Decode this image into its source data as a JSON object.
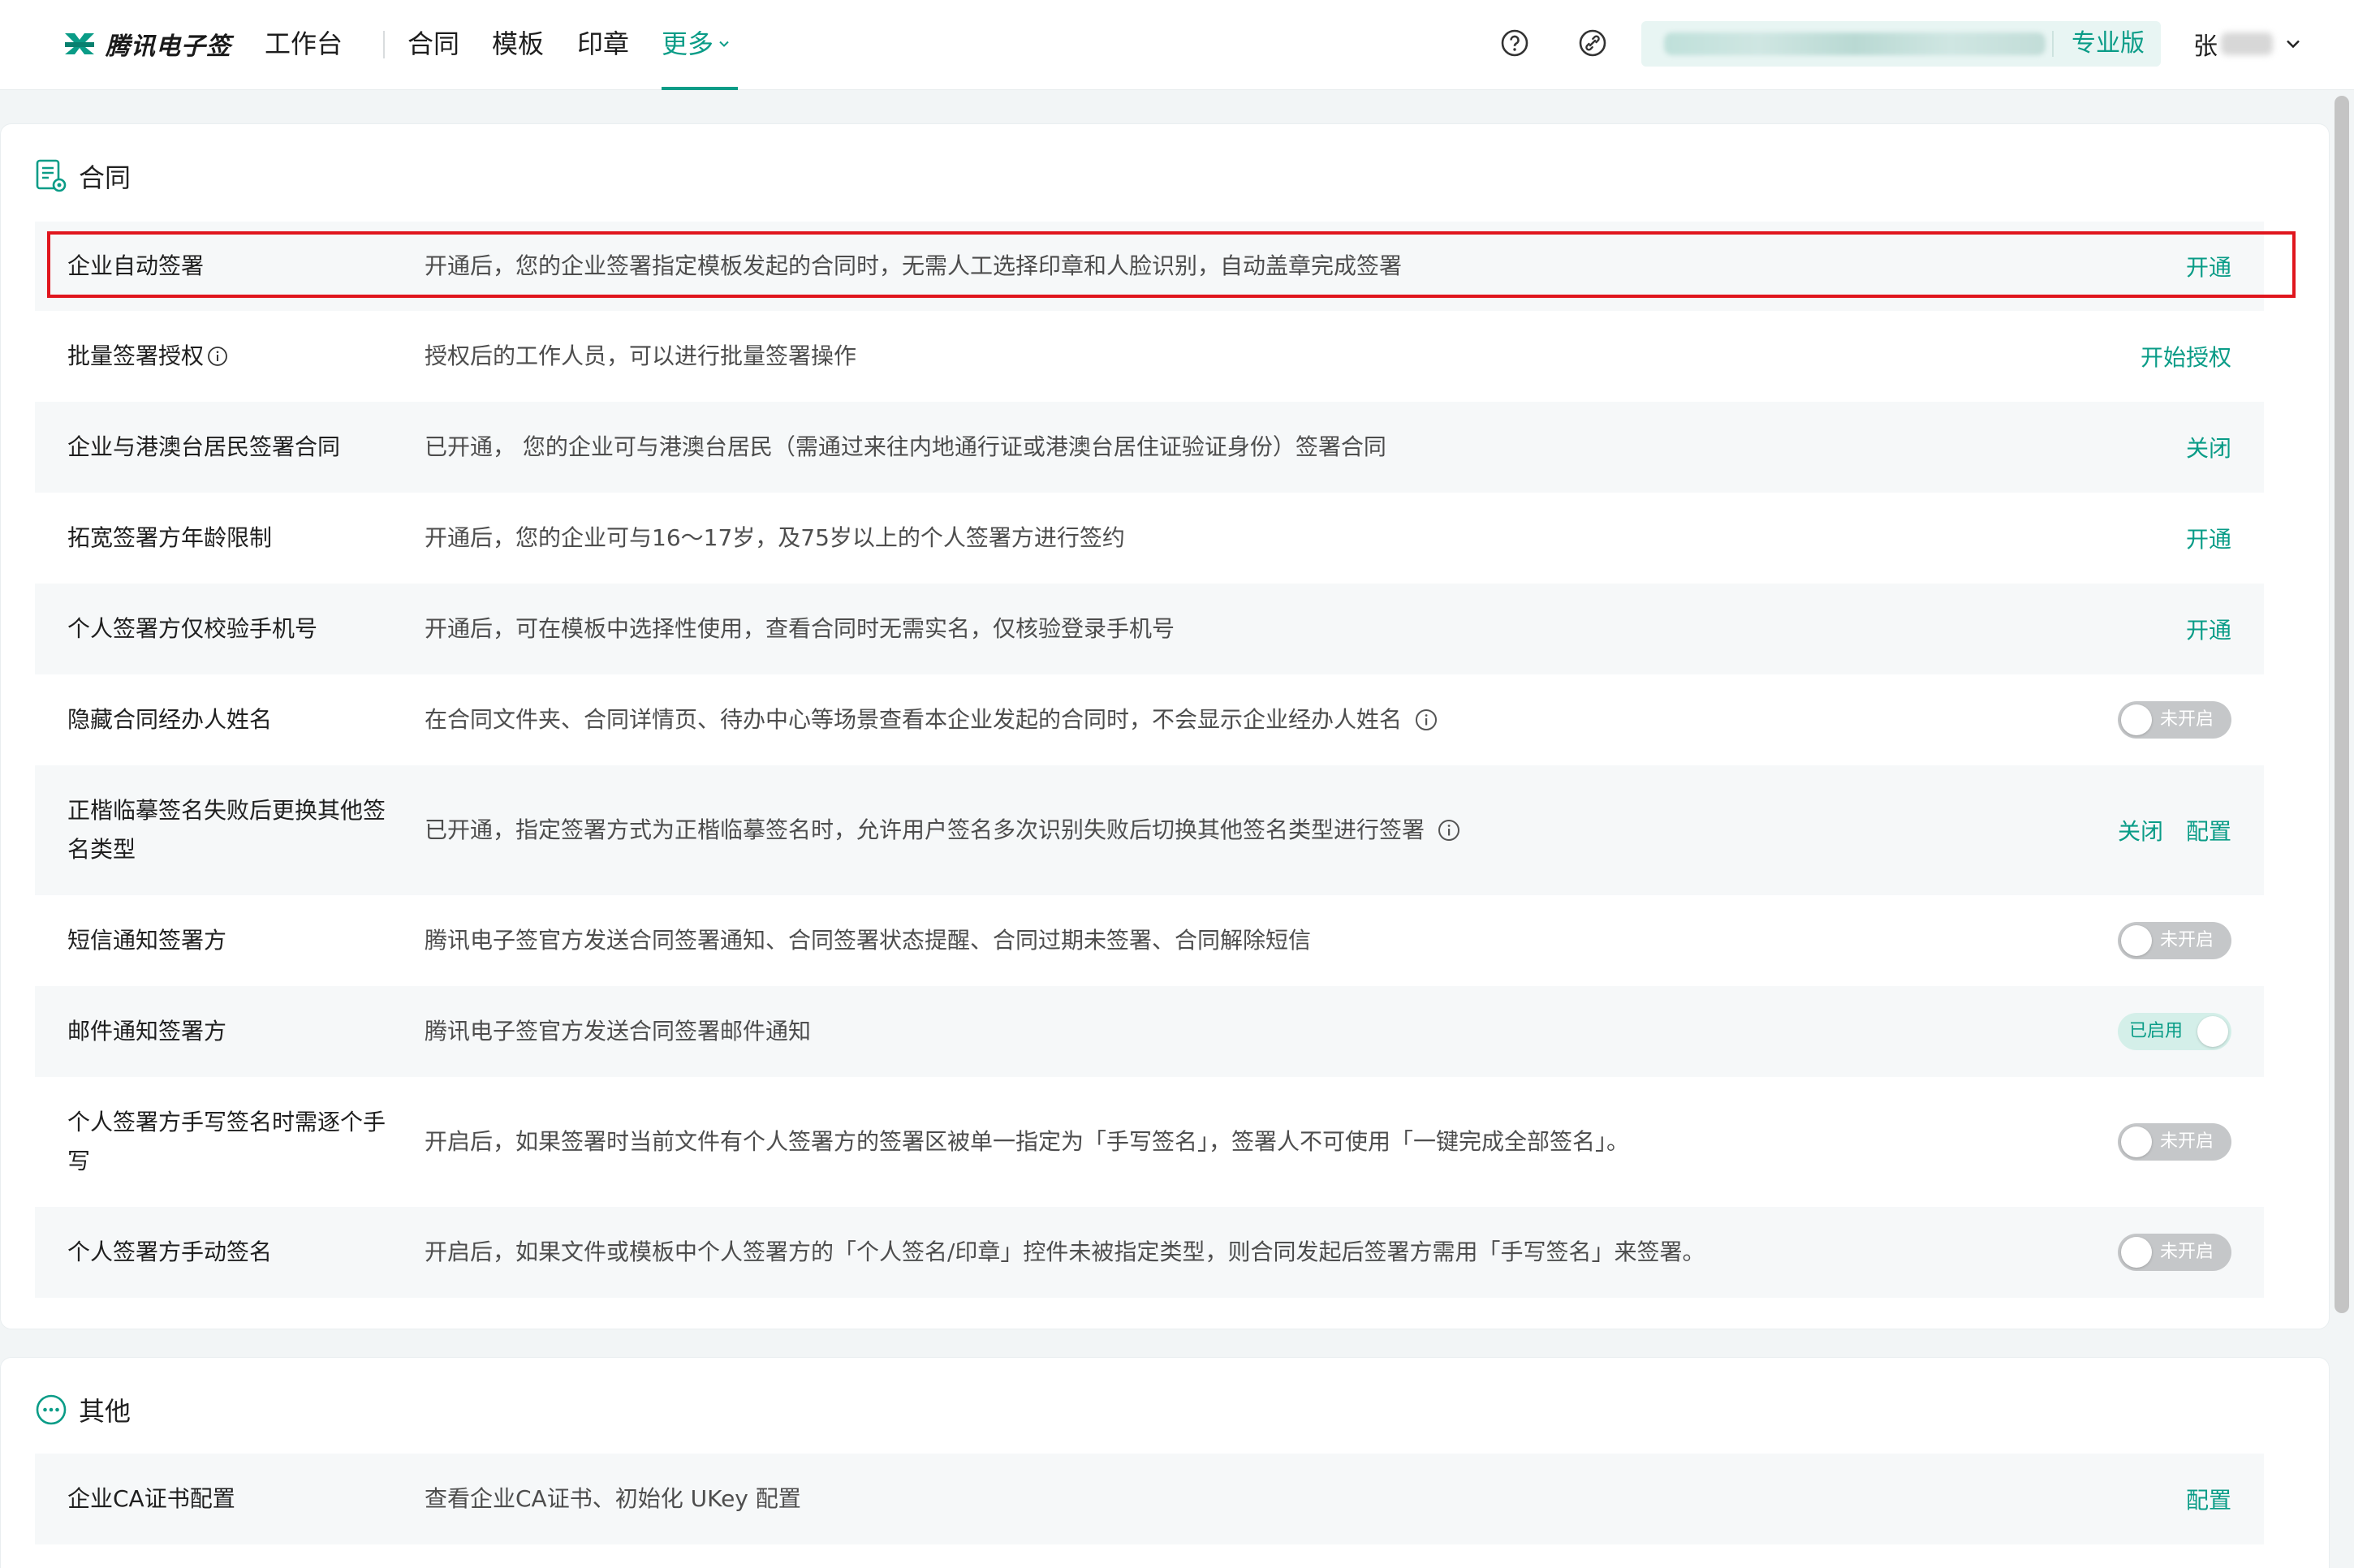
{
  "app": {
    "logo_text": "腾讯电子签",
    "brand_color": "#0a9c87"
  },
  "nav": {
    "workbench": "工作台",
    "contracts": "合同",
    "templates": "模板",
    "seals": "印章",
    "more": "更多"
  },
  "header": {
    "help_icon": "question-circle-icon",
    "link_icon": "link-circle-icon",
    "edition_label": "专业版",
    "user_name": "张"
  },
  "sections": {
    "contract": {
      "title": "合同",
      "rows": [
        {
          "name": "企业自动签署",
          "desc": "开通后，您的企业签署指定模板发起的合同时，无需人工选择印章和人脸识别，自动盖章完成签署",
          "actions": [
            "开通"
          ]
        },
        {
          "name": "批量签署授权",
          "desc": "授权后的工作人员，可以进行批量签署操作",
          "actions": [
            "开始授权"
          ]
        },
        {
          "name": "企业与港澳台居民签署合同",
          "desc": "已开通， 您的企业可与港澳台居民（需通过来往内地通行证或港澳台居住证验证身份）签署合同",
          "actions": [
            "关闭"
          ]
        },
        {
          "name": "拓宽签署方年龄限制",
          "desc": "开通后，您的企业可与16～17岁，及75岁以上的个人签署方进行签约",
          "actions": [
            "开通"
          ]
        },
        {
          "name": "个人签署方仅校验手机号",
          "desc": "开通后，可在模板中选择性使用，查看合同时无需实名，仅核验登录手机号",
          "actions": [
            "开通"
          ]
        },
        {
          "name": "隐藏合同经办人姓名",
          "desc": "在合同文件夹、合同详情页、待办中心等场景查看本企业发起的合同时，不会显示企业经办人姓名",
          "toggle": "未开启"
        },
        {
          "name": "正楷临摹签名失败后更换其他签名类型",
          "desc": "已开通，指定签署方式为正楷临摹签名时，允许用户签名多次识别失败后切换其他签名类型进行签署",
          "actions": [
            "关闭",
            "配置"
          ]
        },
        {
          "name": "短信通知签署方",
          "desc": "腾讯电子签官方发送合同签署通知、合同签署状态提醒、合同过期未签署、合同解除短信",
          "toggle": "未开启"
        },
        {
          "name": "邮件通知签署方",
          "desc": "腾讯电子签官方发送合同签署邮件通知",
          "toggle": "已启用"
        },
        {
          "name": "个人签署方手写签名时需逐个手写",
          "desc": "开启后，如果签署时当前文件有个人签署方的签署区被单一指定为「手写签名」，签署人不可使用「一键完成全部签名」。",
          "toggle": "未开启"
        },
        {
          "name": "个人签署方手动签名",
          "desc": "开启后，如果文件或模板中个人签署方的「个人签名/印章」控件未被指定类型，则合同发起后签署方需用「手写签名」来签署。",
          "toggle": "未开启"
        }
      ]
    },
    "other": {
      "title": "其他",
      "rows": [
        {
          "name": "企业CA证书配置",
          "desc": "查看企业CA证书、初始化 UKey 配置",
          "actions": [
            "配置"
          ]
        }
      ]
    }
  }
}
